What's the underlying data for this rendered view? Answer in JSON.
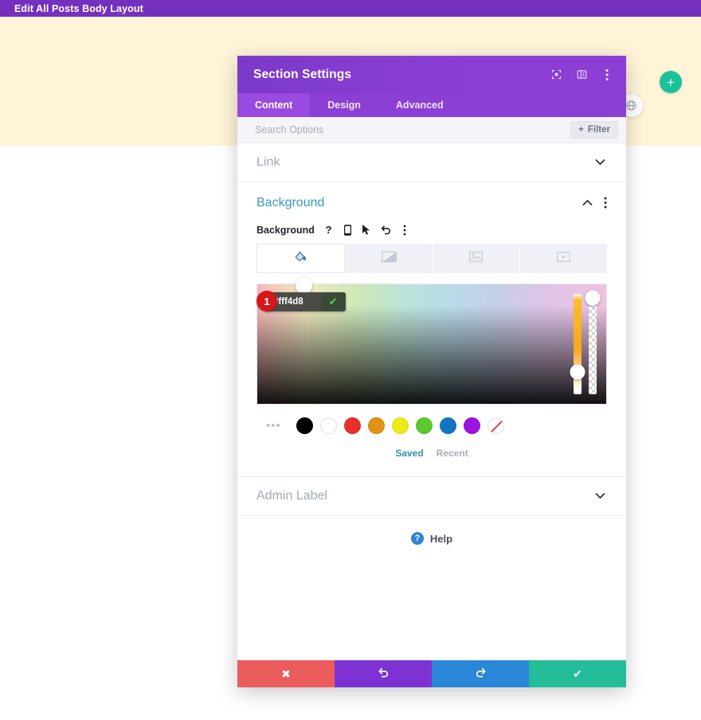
{
  "adminbar": {
    "title": "Edit All Posts Body Layout"
  },
  "canvas": {
    "background_color": "#fff4d8",
    "add_button_label": "+",
    "add_button_icon": "plus-icon",
    "globe_icon": "globe-icon"
  },
  "modal": {
    "title": "Section Settings",
    "header_icons": [
      {
        "name": "focus-target-icon"
      },
      {
        "name": "layout-panel-icon"
      },
      {
        "name": "vertical-dots-icon"
      }
    ],
    "tabs": [
      {
        "label": "Content",
        "active": true
      },
      {
        "label": "Design",
        "active": false
      },
      {
        "label": "Advanced",
        "active": false
      }
    ],
    "search": {
      "placeholder": "Search Options",
      "value": "",
      "filter_label": "Filter",
      "filter_icon": "plus-icon"
    },
    "sections": {
      "link": {
        "label": "Link",
        "chevron": "chevron-down-icon"
      },
      "background": {
        "title": "Background",
        "collapse_icon": "chevron-up-icon",
        "menu_icon": "vertical-dots-icon",
        "field_label": "Background",
        "field_icons": [
          {
            "name": "help-icon",
            "glyph": "?"
          },
          {
            "name": "mobile-icon"
          },
          {
            "name": "cursor-icon"
          },
          {
            "name": "undo-icon"
          },
          {
            "name": "vertical-dots-icon"
          }
        ],
        "type_tabs": [
          {
            "name": "background-color-tab",
            "icon": "paint-bucket-icon",
            "active": true
          },
          {
            "name": "background-gradient-tab",
            "icon": "gradient-icon",
            "active": false
          },
          {
            "name": "background-image-tab",
            "icon": "image-icon",
            "active": false
          },
          {
            "name": "background-video-tab",
            "icon": "video-icon",
            "active": false
          }
        ],
        "color_picker": {
          "hex_value": "#fff4d8",
          "confirm_icon": "check-icon",
          "step_badge": "1",
          "hue_slider": {
            "name": "hue-slider",
            "handle_position_pct": 78
          },
          "alpha_slider": {
            "name": "alpha-slider",
            "handle_position_pct": 4
          }
        },
        "swatches": {
          "more_icon": "ellipsis-icon",
          "colors": [
            {
              "name": "swatch-black",
              "hex": "#000000"
            },
            {
              "name": "swatch-white",
              "hex": "#ffffff"
            },
            {
              "name": "swatch-red",
              "hex": "#e8302a"
            },
            {
              "name": "swatch-orange",
              "hex": "#e39117"
            },
            {
              "name": "swatch-yellow",
              "hex": "#edea17"
            },
            {
              "name": "swatch-green",
              "hex": "#5ec92f"
            },
            {
              "name": "swatch-blue",
              "hex": "#1474c4"
            },
            {
              "name": "swatch-purple",
              "hex": "#9d14e0"
            },
            {
              "name": "swatch-transparent",
              "hex": "transparent"
            }
          ],
          "tabs": [
            {
              "label": "Saved",
              "active": true
            },
            {
              "label": "Recent",
              "active": false
            }
          ]
        }
      },
      "admin_label": {
        "label": "Admin Label",
        "chevron": "chevron-down-icon"
      }
    },
    "help": {
      "label": "Help",
      "icon": "help-circle-icon"
    },
    "footer": [
      {
        "name": "cancel-button",
        "icon": "close-icon",
        "color": "#eb5c5c"
      },
      {
        "name": "undo-button",
        "icon": "undo-icon",
        "color": "#7d32d4"
      },
      {
        "name": "redo-button",
        "icon": "redo-icon",
        "color": "#2a87d8"
      },
      {
        "name": "save-button",
        "icon": "check-icon",
        "color": "#23bd9a"
      }
    ]
  }
}
